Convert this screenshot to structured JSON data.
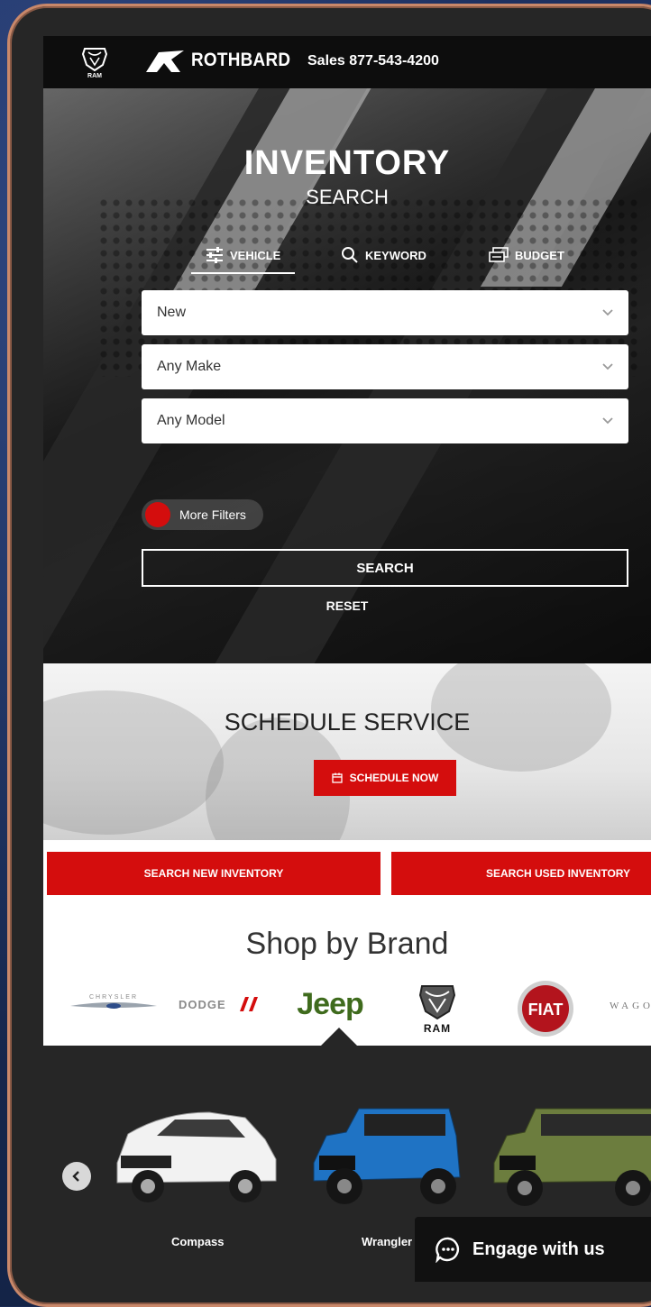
{
  "header": {
    "brand_name": "ROTHBARD",
    "ram_badge_text": "RAM",
    "sales_text": "Sales 877-543-4200"
  },
  "hero": {
    "title": "INVENTORY",
    "subtitle": "SEARCH",
    "tabs": [
      {
        "label": "VEHICLE",
        "icon": "sliders-icon",
        "active": true
      },
      {
        "label": "KEYWORD",
        "icon": "search-icon",
        "active": false
      },
      {
        "label": "BUDGET",
        "icon": "money-icon",
        "active": false
      }
    ],
    "selects": [
      {
        "value": "New"
      },
      {
        "value": "Any Make"
      },
      {
        "value": "Any Model"
      }
    ],
    "more_filters_label": "More Filters",
    "search_label": "SEARCH",
    "reset_label": "RESET"
  },
  "schedule": {
    "title": "SCHEDULE SERVICE",
    "button_label": "SCHEDULE NOW"
  },
  "inventory": {
    "new_label": "SEARCH NEW INVENTORY",
    "used_label": "SEARCH USED INVENTORY"
  },
  "brands": {
    "heading": "Shop by Brand",
    "items": [
      {
        "name": "CHRYSLER"
      },
      {
        "name": "DODGE"
      },
      {
        "name": "Jeep"
      },
      {
        "name": "RAM"
      },
      {
        "name": "FIAT"
      },
      {
        "name": "WAGO"
      }
    ]
  },
  "carousel": {
    "cars": [
      {
        "name": "Compass",
        "color": "#f2f2f2"
      },
      {
        "name": "Wrangler",
        "color": "#1f73c4"
      },
      {
        "name": "",
        "color": "#6c7d3e"
      }
    ]
  },
  "chat": {
    "label": "Engage with us"
  },
  "colors": {
    "accent": "#d40d0d",
    "header_bg": "#0d0d0d",
    "carousel_bg": "#262626"
  }
}
